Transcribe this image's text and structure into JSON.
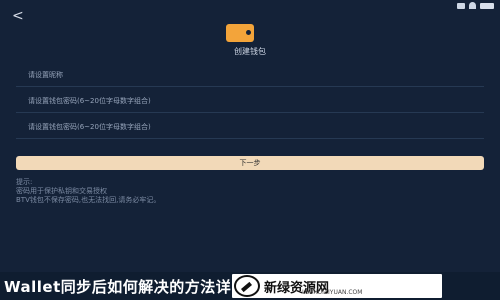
{
  "status_bar": {
    "icons": [
      "signal-icon",
      "wifi-icon",
      "battery-icon"
    ]
  },
  "nav": {
    "back_glyph": "<"
  },
  "header": {
    "title": "创建钱包",
    "icon": "wallet-icon",
    "icon_color": "#f3a43a"
  },
  "form": {
    "fields": [
      {
        "placeholder": "请设置昵称"
      },
      {
        "placeholder": "请设置钱包密码(6~20位字母数字组合)"
      },
      {
        "placeholder": "请设置钱包密码(6~20位字母数字组合)"
      }
    ],
    "next_label": "下一步"
  },
  "tip": {
    "title": "提示:",
    "lines": [
      "密码用于保护私钥和交易授权",
      "BTV钱包不保存密码,也无法找回,请务必牢记。"
    ]
  },
  "footer": {
    "banner_text": "Wallet同步后如何解决的方法详",
    "logo_text": "新绿资源网",
    "logo_sub": "LUSHUIZIYUAN.COM"
  },
  "colors": {
    "background": "#142238",
    "button_bg": "#f2d9b8",
    "field_text": "#96a4ba"
  }
}
